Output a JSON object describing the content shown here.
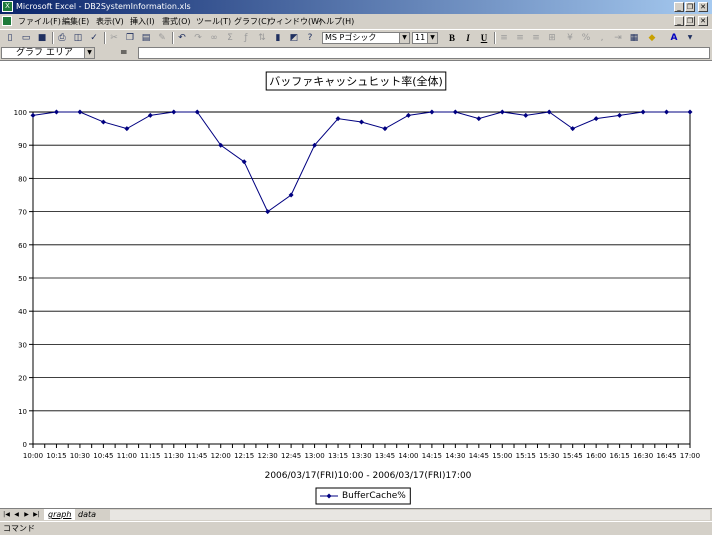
{
  "window": {
    "title": "Microsoft Excel - DB2SystemInformation.xls",
    "app_icon": "excel-icon",
    "app_icon_glyph": "X",
    "controls": {
      "minimize": "_",
      "restore": "❐",
      "close": "✕"
    }
  },
  "menu": {
    "items": [
      "ファイル(F)",
      "編集(E)",
      "表示(V)",
      "挿入(I)",
      "書式(O)",
      "ツール(T)",
      "グラフ(C)",
      "ウィンドウ(W)",
      "ヘルプ(H)"
    ],
    "doc_controls": {
      "minimize": "_",
      "restore": "❐",
      "close": "✕"
    }
  },
  "toolbar": {
    "font_name": "MS Pゴシック",
    "font_size": "11",
    "bold": "B",
    "italic": "I",
    "underline": "U",
    "dropdown_glyph": "▼"
  },
  "formula_bar": {
    "name_box": "グラフ エリア",
    "equals": "=",
    "dropdown_glyph": "▼"
  },
  "chart_data": {
    "type": "line",
    "title": "バッファキャッシュヒット率(全体)",
    "xlabel": "2006/03/17(FRI)10:00 - 2006/03/17(FRI)17:00",
    "ylabel": "",
    "ylim": [
      0,
      100
    ],
    "yticks": [
      "0",
      "10",
      "20",
      "30",
      "40",
      "50",
      "60",
      "70",
      "80",
      "90",
      "100"
    ],
    "categories": [
      "10:00",
      "10:15",
      "10:30",
      "10:45",
      "11:00",
      "11:15",
      "11:30",
      "11:45",
      "12:00",
      "12:15",
      "12:30",
      "12:45",
      "13:00",
      "13:15",
      "13:30",
      "13:45",
      "14:00",
      "14:15",
      "14:30",
      "14:45",
      "15:00",
      "15:15",
      "15:30",
      "15:45",
      "16:00",
      "16:15",
      "16:30",
      "16:45",
      "17:00"
    ],
    "x": [
      0,
      0.5,
      1,
      1.5,
      2,
      2.5,
      3,
      3.5,
      4,
      4.5,
      5,
      5.5,
      6,
      6.5,
      7,
      7.5,
      8,
      8.5,
      9,
      9.5,
      10,
      10.5,
      11,
      11.5,
      12,
      12.5,
      13,
      13.5,
      14,
      14.5,
      15,
      15.5,
      16,
      16.5,
      17,
      17.5,
      18,
      18.5,
      19,
      19.5,
      20,
      20.5,
      21,
      21.5,
      22,
      22.5,
      23,
      23.5,
      24,
      24.5,
      25,
      25.5,
      26,
      26.5,
      27,
      27.5,
      28
    ],
    "series": [
      {
        "name": "BufferCache%",
        "color": "#000080",
        "values": [
          99,
          100,
          100,
          97,
          95,
          99,
          100,
          100,
          90,
          85,
          70,
          75,
          90,
          98,
          97,
          95,
          99,
          100,
          100,
          98,
          100,
          99,
          100,
          95,
          98,
          99,
          100,
          100,
          100
        ]
      }
    ],
    "grid": true,
    "legend": "bottom"
  },
  "sheet_tabs": {
    "nav": [
      "|◀",
      "◀",
      "▶",
      "▶|"
    ],
    "tabs": [
      "graph",
      "data"
    ],
    "active": "graph"
  },
  "status": {
    "text": "コマンド"
  }
}
